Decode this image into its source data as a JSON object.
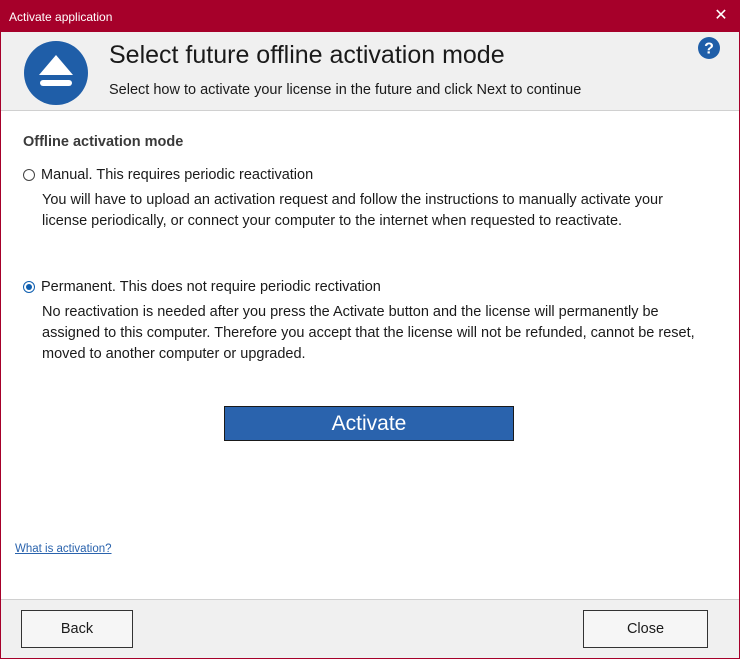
{
  "window": {
    "title": "Activate application",
    "close_glyph": "✕"
  },
  "header": {
    "heading": "Select future offline activation mode",
    "subheading": "Select how to activate your license in the future and click Next to continue",
    "logo_icon": "eject-icon",
    "help_glyph": "?"
  },
  "content": {
    "section_title": "Offline activation mode",
    "options": [
      {
        "label": "Manual. This requires periodic reactivation",
        "checked": false,
        "description": "You will have to upload an activation request and follow the instructions to manually activate your license periodically, or connect your computer to the internet when requested to reactivate."
      },
      {
        "label": "Permanent. This does not require periodic rectivation",
        "checked": true,
        "description": "No reactivation is needed after you press the Activate button and the license will permanently be assigned to this computer. Therefore you accept that the license will not be refunded, cannot be reset, moved to another computer or upgraded."
      }
    ],
    "activate_label": "Activate",
    "help_link": "What is activation?"
  },
  "footer": {
    "back_label": "Back",
    "close_label": "Close"
  },
  "colors": {
    "titlebar": "#a6002a",
    "accent": "#2a63ad",
    "logo": "#1f5ea8"
  }
}
